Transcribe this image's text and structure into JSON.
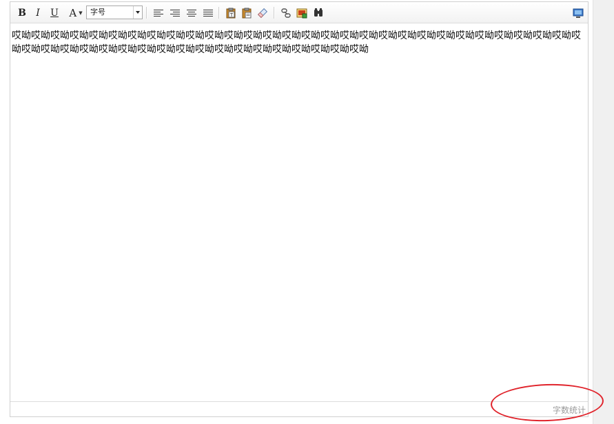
{
  "toolbar": {
    "bold_label": "B",
    "italic_label": "I",
    "underline_label": "U",
    "font_color_label": "A",
    "font_size_select": {
      "selected": "字号"
    },
    "icons": [
      "align-left-icon",
      "align-right-icon",
      "align-center-icon",
      "justify-icon",
      "paste-text-icon",
      "paste-word-icon",
      "eraser-icon",
      "link-icon",
      "image-icon",
      "find-icon",
      "fullscreen-icon"
    ]
  },
  "content": {
    "text": "哎呦哎呦哎呦哎呦哎呦哎呦哎呦哎呦哎呦哎呦哎呦哎呦哎呦哎呦哎呦哎呦哎呦哎呦哎呦哎呦哎呦哎呦哎呦哎呦哎呦哎呦哎呦哎呦哎呦哎呦哎呦哎呦哎呦哎呦哎呦哎呦哎呦哎呦哎呦哎呦哎呦哎呦哎呦哎呦哎呦哎呦哎呦哎呦"
  },
  "statusbar": {
    "word_count_label": "字数统计"
  },
  "colors": {
    "annotation": "#e0232b",
    "border": "#cfcfcf",
    "muted_text": "#9a9a9a"
  }
}
